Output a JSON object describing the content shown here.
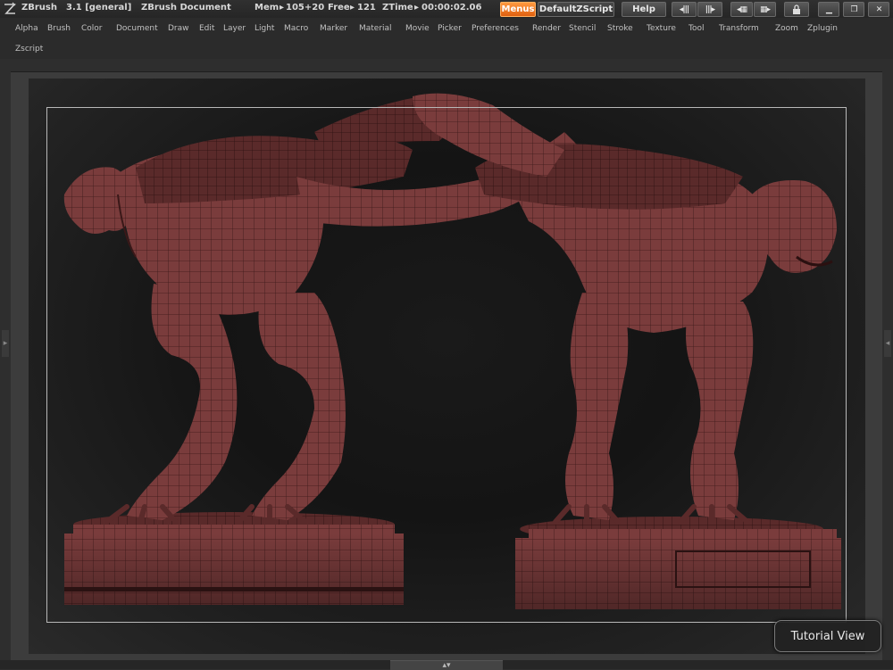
{
  "titlebar": {
    "app_name": "ZBrush",
    "version": "3.1 [general]",
    "document": "ZBrush Document",
    "mem_label": "Mem",
    "mem_value": "105+20",
    "free_label": "Free",
    "free_value": "121",
    "ztime_label": "ZTime",
    "ztime_value": "00:00:02.06",
    "menus_button": "Menus",
    "zscript_button": "DefaultZScript",
    "help_button": "Help"
  },
  "menu": {
    "items": [
      "Alpha",
      "Brush",
      "Color",
      "Document",
      "Draw",
      "Edit",
      "Layer",
      "Light",
      "Macro",
      "Marker",
      "Material",
      "Movie",
      "Picker",
      "Preferences",
      "Render",
      "Stencil",
      "Stroke",
      "Texture",
      "Tool",
      "Transform",
      "Zoom",
      "Zplugin"
    ],
    "second_row": [
      "Zscript"
    ]
  },
  "canvas": {
    "subject": "Two dinosaur models with polygon wireframe on round pedestals"
  },
  "tutorial_label": "Tutorial View",
  "colors": {
    "accent": "#f07a20",
    "model": "#8a4646",
    "wire": "#3a1a1a",
    "background": "#1a1a1a"
  }
}
